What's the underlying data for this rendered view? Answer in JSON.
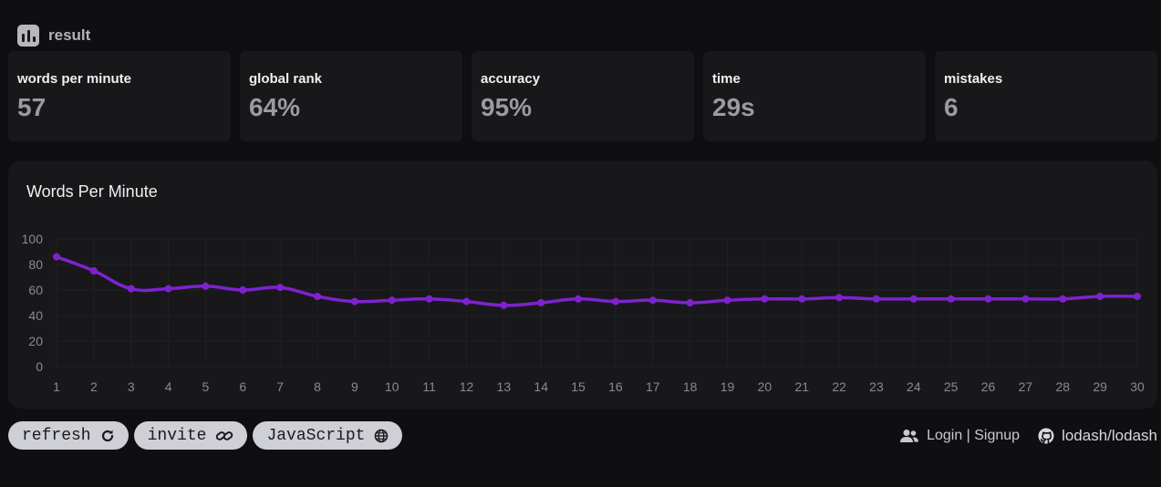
{
  "header": {
    "title": "result",
    "icon": "bar-chart-icon"
  },
  "stats": [
    {
      "label": "words per minute",
      "value": "57"
    },
    {
      "label": "global rank",
      "value": "64%"
    },
    {
      "label": "accuracy",
      "value": "95%"
    },
    {
      "label": "time",
      "value": "29s"
    },
    {
      "label": "mistakes",
      "value": "6"
    }
  ],
  "chart": {
    "title": "Words Per Minute"
  },
  "chart_data": {
    "type": "line",
    "title": "Words Per Minute",
    "xlabel": "",
    "ylabel": "",
    "x": [
      1,
      2,
      3,
      4,
      5,
      6,
      7,
      8,
      9,
      10,
      11,
      12,
      13,
      14,
      15,
      16,
      17,
      18,
      19,
      20,
      21,
      22,
      23,
      24,
      25,
      26,
      27,
      28,
      29,
      30
    ],
    "series": [
      {
        "values": [
          86,
          75,
          61,
          61,
          63,
          60,
          62,
          55,
          51,
          52,
          53,
          51,
          48,
          50,
          53,
          51,
          52,
          50,
          52,
          53,
          53,
          54,
          53,
          53,
          53,
          53,
          53,
          53,
          55,
          55
        ],
        "color": "#7e22ce"
      }
    ],
    "ylim": [
      0,
      100
    ],
    "yticks": [
      0,
      20,
      40,
      60,
      80,
      100
    ],
    "grid": true
  },
  "actions": {
    "refresh": {
      "label": "refresh",
      "icon": "refresh-icon"
    },
    "invite": {
      "label": "invite",
      "icon": "link-icon"
    },
    "language": {
      "label": "JavaScript",
      "icon": "globe-icon"
    }
  },
  "footer": {
    "login": {
      "label": "Login | Signup",
      "icon": "users-icon"
    },
    "repo": {
      "label": "lodash/lodash",
      "icon": "github-icon"
    }
  }
}
